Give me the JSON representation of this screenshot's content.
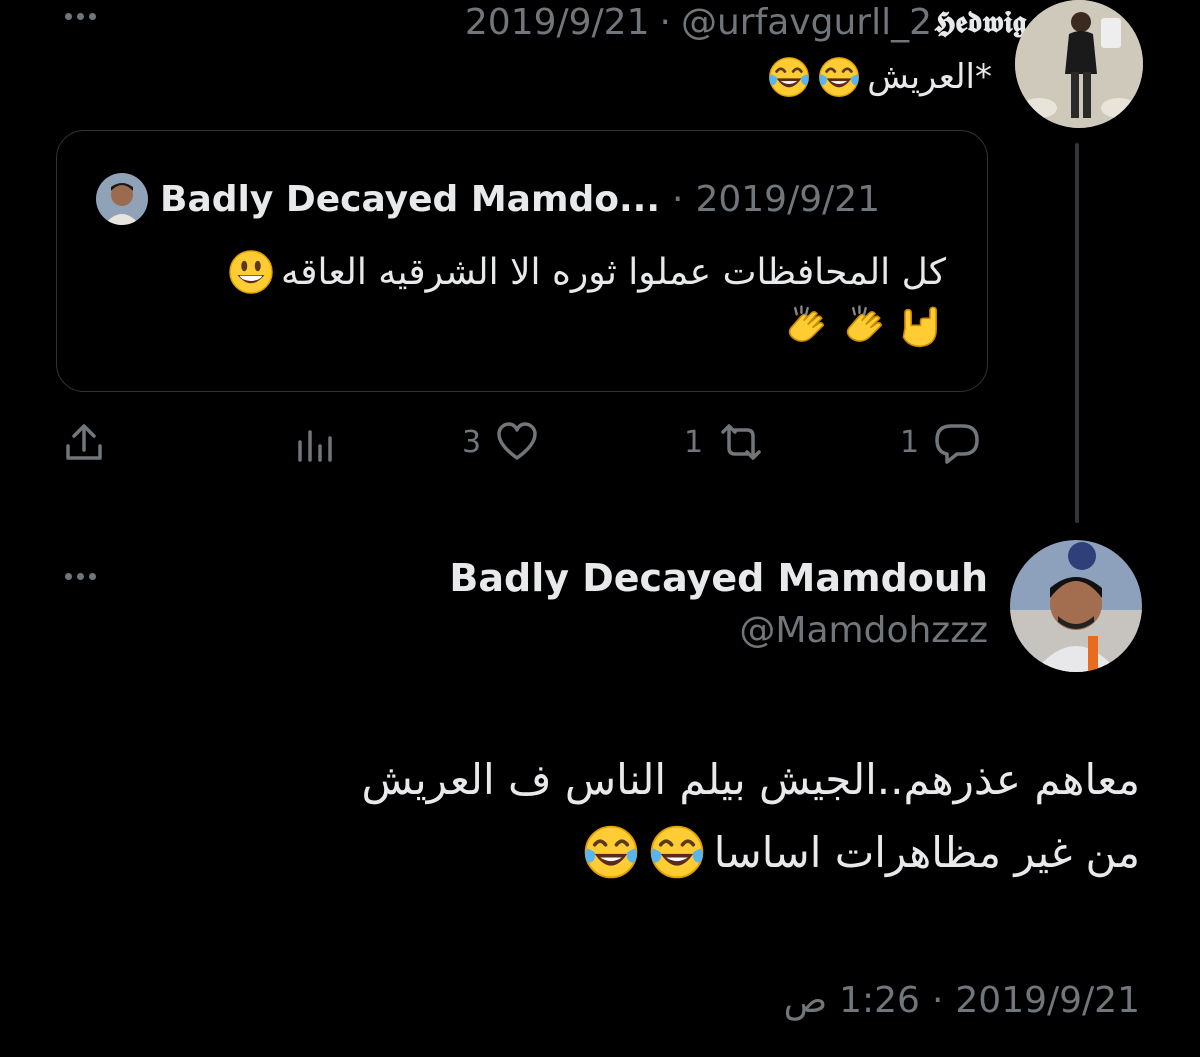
{
  "parent_tweet": {
    "date": "2019/9/21",
    "separator": "·",
    "handle": "@urfavgurll_2",
    "display_name": "𝕳𝖊𝖉𝖜𝖎𝖌",
    "name_emoji": "owl",
    "text": "*العريش",
    "text_emojis": [
      "face-with-tears-of-joy",
      "face-with-tears-of-joy"
    ]
  },
  "quoted_tweet": {
    "author_name": "Badly Decayed Mamdo...",
    "separator": "·",
    "date": "2019/9/21",
    "text_line1": "كل المحافظات عملوا ثوره الا الشرقيه العاقه",
    "line1_emoji": "grinning-face",
    "line2_emojis": [
      "clapping-hands",
      "clapping-hands",
      "love-you-gesture"
    ]
  },
  "actions": {
    "reply_count": "1",
    "retweet_count": "1",
    "like_count": "3",
    "reply_icon": "reply-icon",
    "retweet_icon": "retweet-icon",
    "like_icon": "heart-icon",
    "analytics_icon": "analytics-icon",
    "share_icon": "share-icon"
  },
  "main_tweet": {
    "author_name": "Badly Decayed Mamdouh",
    "handle": "@Mamdohzzz",
    "text_line1": "معاهم عذرهم..الجيش بيلم الناس ف العريش",
    "text_line2": "من غير مظاهرات اساسا",
    "line2_emojis": [
      "face-with-tears-of-joy",
      "face-with-tears-of-joy"
    ],
    "timestamp_date": "2019/9/21",
    "timestamp_separator": "·",
    "timestamp_time": "1:26",
    "timestamp_ampm": "ص"
  },
  "colors": {
    "background": "#000000",
    "text_primary": "#e7e9ea",
    "text_secondary": "#71767b",
    "border": "#2f3336"
  }
}
